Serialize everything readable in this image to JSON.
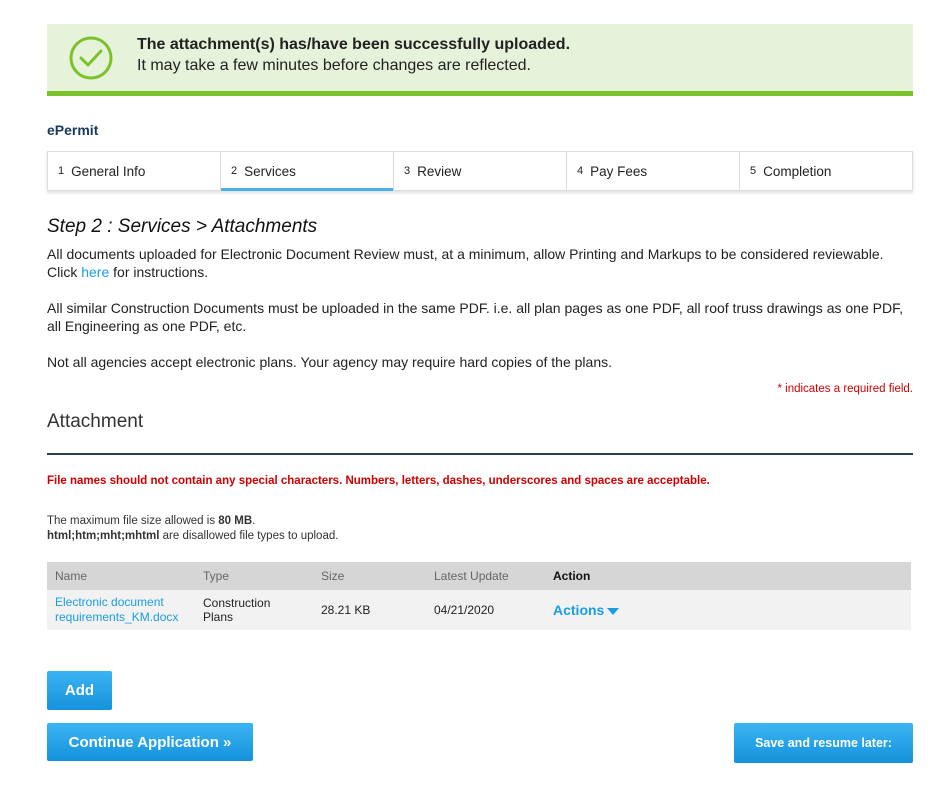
{
  "banner": {
    "title": "The attachment(s) has/have been successfully uploaded.",
    "subtitle": "It may take a few minutes before changes are reflected.",
    "icon": "check-circle-icon",
    "accent": "#7cc22a"
  },
  "module_name": "ePermit",
  "steps": [
    {
      "num": "1",
      "label": "General Info"
    },
    {
      "num": "2",
      "label": "Services"
    },
    {
      "num": "3",
      "label": "Review"
    },
    {
      "num": "4",
      "label": "Pay Fees"
    },
    {
      "num": "5",
      "label": "Completion"
    }
  ],
  "active_step": "2",
  "step_title": "Step 2 : Services > Attachments",
  "paragraphs": {
    "p1_before": "All documents uploaded for Electronic Document Review must, at a minimum, allow Printing and Markups to be considered reviewable. Click ",
    "p1_link": "here",
    "p1_after": " for instructions.",
    "p2": "All similar Construction Documents must be uploaded in the same PDF. i.e. all plan pages as one PDF, all roof truss drawings as one PDF, all Engineering as one PDF, etc.",
    "p3": "Not all agencies accept electronic plans.  Your agency may require hard copies of the plans."
  },
  "required_note": "* indicates a required field.",
  "section_title": "Attachment",
  "warning": "File names should not contain any special characters. Numbers, letters, dashes, underscores and spaces are acceptable.",
  "file_info": {
    "max_size_prefix": "The maximum file size allowed is ",
    "max_size_value": "80 MB",
    "max_size_suffix": ".",
    "disallowed_types": "html;htm;mht;mhtml",
    "disallowed_suffix": " are disallowed file types to upload."
  },
  "table": {
    "headers": {
      "name": "Name",
      "type": "Type",
      "size": "Size",
      "latest_update": "Latest Update",
      "action": "Action"
    },
    "rows": [
      {
        "name_line1": "Electronic document",
        "name_line2": "requirements_KM.docx",
        "type_line1": "Construction",
        "type_line2": "Plans",
        "size": "28.21 KB",
        "latest_update": "04/21/2020",
        "action": "Actions"
      }
    ]
  },
  "buttons": {
    "add": "Add",
    "continue": "Continue Application »",
    "save": "Save and resume later:"
  },
  "colors": {
    "link": "#1a9ee0",
    "button": "#1592dc",
    "required": "#d00000",
    "banner_bg": "#e6f2da"
  }
}
